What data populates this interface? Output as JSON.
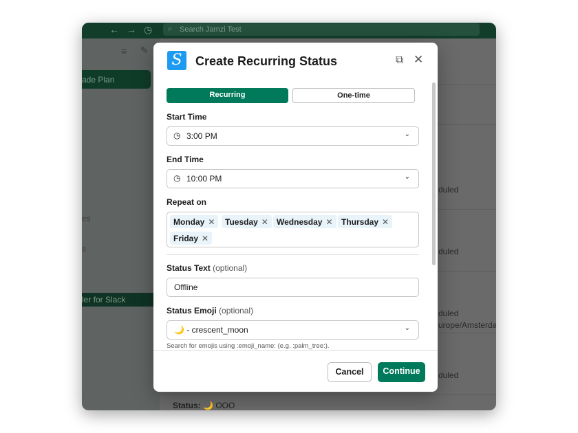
{
  "app": {
    "search_placeholder": "Search Jamzi Test"
  },
  "sidebar": {
    "active_item": "ade Plan",
    "items": [
      "es",
      "s"
    ],
    "app_item": "ler for Slack"
  },
  "background": {
    "rows": [
      "duled",
      "duled",
      "duled",
      "urope/Amsterda",
      "duled"
    ],
    "status_label": "Status:",
    "status_emoji": "🌙",
    "status_value": "OOO"
  },
  "modal": {
    "title": "Create Recurring Status",
    "logo_letter": "S",
    "tabs": [
      {
        "label": "Recurring",
        "active": true
      },
      {
        "label": "One-time",
        "active": false
      }
    ],
    "start_time": {
      "label": "Start Time",
      "value": "3:00 PM"
    },
    "end_time": {
      "label": "End Time",
      "value": "10:00 PM"
    },
    "repeat_on": {
      "label": "Repeat on",
      "days": [
        "Monday",
        "Tuesday",
        "Wednesday",
        "Thursday",
        "Friday"
      ]
    },
    "status_text": {
      "label": "Status Text",
      "optional": "(optional)",
      "value": "Offline"
    },
    "status_emoji": {
      "label": "Status Emoji",
      "optional": "(optional)",
      "emoji": "🌙",
      "value": "- crescent_moon",
      "help": "Search for emojis using :emoji_name: (e.g. :palm_tree:)."
    },
    "cancel_label": "Cancel",
    "continue_label": "Continue"
  },
  "colors": {
    "brand": "#007a5a",
    "titlebar": "#123d2b",
    "logo": "#1d9bf0"
  }
}
